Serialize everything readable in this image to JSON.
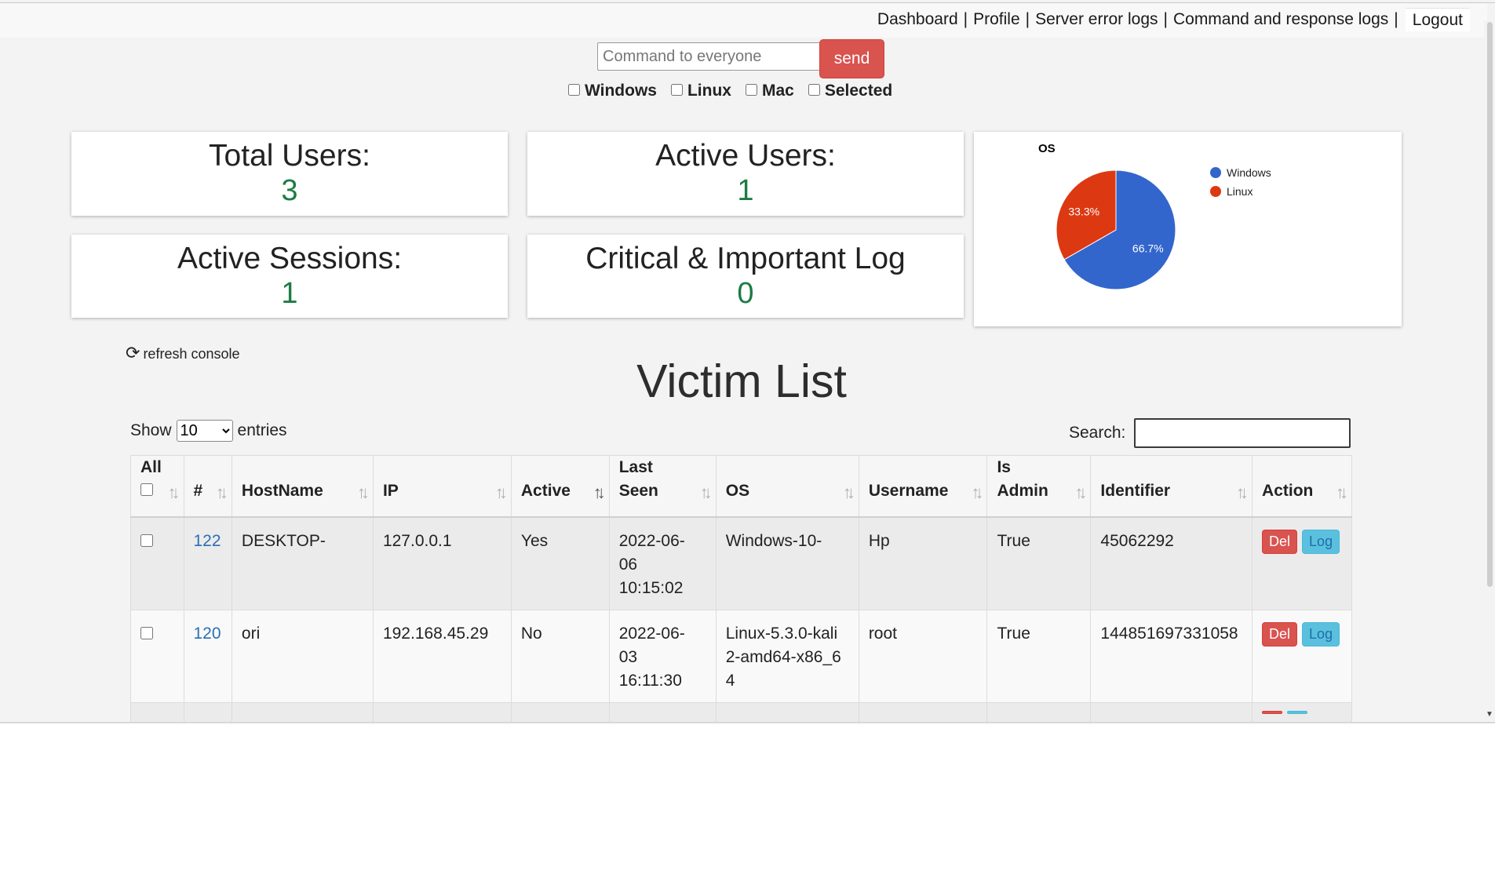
{
  "nav": {
    "dashboard": "Dashboard",
    "profile": "Profile",
    "server_error_logs": "Server error logs",
    "command_logs": "Command and response logs",
    "logout": "Logout",
    "separator": "|"
  },
  "command": {
    "placeholder": "Command to everyone",
    "value": "",
    "send_label": "send",
    "targets": [
      {
        "label": "Windows",
        "checked": false
      },
      {
        "label": "Linux",
        "checked": false
      },
      {
        "label": "Mac",
        "checked": false
      },
      {
        "label": "Selected",
        "checked": false
      }
    ]
  },
  "stats": {
    "total_users": {
      "label": "Total Users:",
      "value": "3"
    },
    "active_users": {
      "label": "Active Users:",
      "value": "1"
    },
    "active_sessions": {
      "label": "Active Sessions:",
      "value": "1"
    },
    "critical_log": {
      "label": "Critical & Important Log",
      "value": "0"
    }
  },
  "chart_data": {
    "type": "pie",
    "title": "OS",
    "legend_position": "right",
    "slices": [
      {
        "label": "Windows",
        "value": 66.7,
        "display": "66.7%",
        "color": "#3366cc"
      },
      {
        "label": "Linux",
        "value": 33.3,
        "display": "33.3%",
        "color": "#dc3912"
      }
    ]
  },
  "refresh_label": "refresh console",
  "table_title": "Victim List",
  "length": {
    "show": "Show",
    "entries": "entries",
    "selected": "10",
    "options": [
      "10"
    ]
  },
  "search": {
    "label": "Search:",
    "value": ""
  },
  "table": {
    "sort_glyph": "↑↓",
    "columns": [
      "All",
      "#",
      "HostName",
      "IP",
      "Active",
      "Last Seen",
      "OS",
      "Username",
      "Is Admin",
      "Identifier",
      "Action"
    ],
    "rows": [
      {
        "id": "122",
        "hostname": "DESKTOP-",
        "ip": "127.0.0.1",
        "active": "Yes",
        "last_seen": "2022-06-06 10:15:02",
        "os": "Windows-10-",
        "username": "Hp",
        "is_admin": "True",
        "identifier": "45062292"
      },
      {
        "id": "120",
        "hostname": "ori",
        "ip": "192.168.45.29",
        "active": "No",
        "last_seen": "2022-06-03 16:11:30",
        "os": "Linux-5.3.0-kali2-amd64-x86_64",
        "username": "root",
        "is_admin": "True",
        "identifier": "144851697331058"
      }
    ],
    "del_label": "Del",
    "log_label": "Log"
  }
}
